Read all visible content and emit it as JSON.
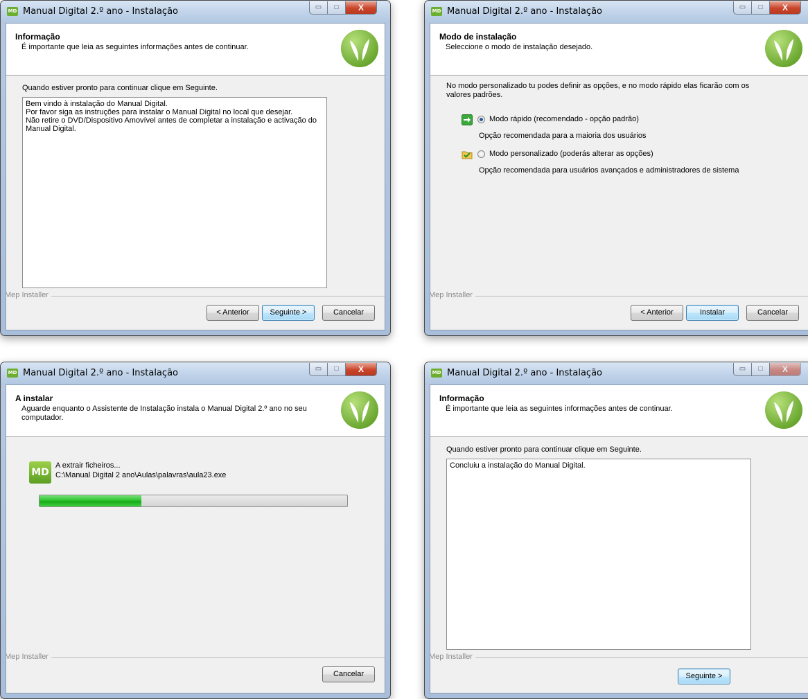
{
  "app": {
    "title": "Manual Digital 2.º ano - Instalação",
    "icon_text": "MD",
    "installer_label": "Mep Installer"
  },
  "window_controls": {
    "minimize": "▭",
    "maximize": "□",
    "close": "X"
  },
  "win1": {
    "header_title": "Informação",
    "header_subtitle": "É importante que leia as seguintes informações antes de continuar.",
    "instruction": "Quando estiver pronto para continuar clique em Seguinte.",
    "memo_lines": [
      "Bem vindo à instalação do Manual Digital.",
      "Por favor siga as instruções para instalar o Manual Digital no local que desejar.",
      "Não retire o DVD/Dispositivo Amovível antes de completar a instalação e activação do Manual Digital."
    ],
    "buttons": {
      "back": "< Anterior",
      "next": "Seguinte >",
      "cancel": "Cancelar"
    }
  },
  "win2": {
    "header_title": "Modo de instalação",
    "header_subtitle": "Seleccione o modo de instalação desejado.",
    "description": "No modo personalizado tu podes definir as opções, e no modo rápido elas ficarão com os valores padrões.",
    "options": [
      {
        "label": "Modo rápido (recomendado - opção padrão)",
        "desc": "Opção recomendada para a maioria dos usuários",
        "selected": true,
        "icon": "green-arrow-icon"
      },
      {
        "label": "Modo personalizado (poderás alterar as opções)",
        "desc": "Opção recomendada para usuários avançados e administradores de sistema",
        "selected": false,
        "icon": "folder-check-icon"
      }
    ],
    "buttons": {
      "back": "< Anterior",
      "install": "Instalar",
      "cancel": "Cancelar"
    }
  },
  "win3": {
    "header_title": "A instalar",
    "header_subtitle": "Aguarde enquanto o Assistente de Instalação instala o Manual Digital 2.º ano no seu computador.",
    "status": "A extrair ficheiros...",
    "file_path": "C:\\Manual Digital 2 ano\\Aulas\\palavras\\aula23.exe",
    "progress": 0.33,
    "buttons": {
      "cancel": "Cancelar"
    }
  },
  "win4": {
    "header_title": "Informação",
    "header_subtitle": "É importante que leia as seguintes informações antes de continuar.",
    "instruction": "Quando estiver pronto para continuar clique em Seguinte.",
    "memo_text": "Concluiu a instalação do Manual Digital.",
    "buttons": {
      "next": "Seguinte >"
    }
  },
  "colors": {
    "accent_green": "#6cae2e",
    "progress_green": "#17a817",
    "close_red": "#c9442a"
  }
}
